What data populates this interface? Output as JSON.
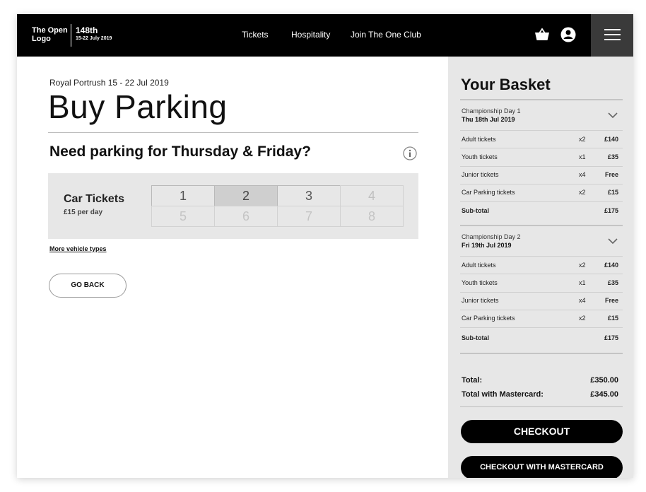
{
  "header": {
    "logo_line1": "The Open",
    "logo_line2": "Logo",
    "edition": "148th",
    "edition_dates": "15-22 July 2019",
    "nav": [
      "Tickets",
      "Hospitality",
      "Join The One Club"
    ],
    "icons": [
      "basket-icon",
      "user-icon",
      "menu-icon"
    ]
  },
  "main": {
    "subtitle": "Royal Portrush 15 - 22 Jul 2019",
    "title": "Buy Parking",
    "question": "Need parking for Thursday & Friday?",
    "tickets_title": "Car Tickets",
    "tickets_price": "£15 per day",
    "quantities": [
      "1",
      "2",
      "3",
      "4",
      "5",
      "6",
      "7",
      "8"
    ],
    "selected_quantity": "2",
    "more_link": "More vehicle types",
    "back_button": "GO BACK"
  },
  "basket": {
    "title": "Your Basket",
    "days": [
      {
        "name": "Championship Day 1",
        "date": "Thu 18th Jul 2019",
        "rows": [
          {
            "label": "Adult tickets",
            "qty": "x2",
            "price": "£140"
          },
          {
            "label": "Youth tickets",
            "qty": "x1",
            "price": "£35"
          },
          {
            "label": "Junior tickets",
            "qty": "x4",
            "price": "Free"
          },
          {
            "label": "Car Parking tickets",
            "qty": "x2",
            "price": "£15"
          }
        ],
        "subtotal_label": "Sub-total",
        "subtotal": "£175"
      },
      {
        "name": "Championship Day 2",
        "date": "Fri 19th Jul 2019",
        "rows": [
          {
            "label": "Adult tickets",
            "qty": "x2",
            "price": "£140"
          },
          {
            "label": "Youth tickets",
            "qty": "x1",
            "price": "£35"
          },
          {
            "label": "Junior tickets",
            "qty": "x4",
            "price": "Free"
          },
          {
            "label": "Car Parking tickets",
            "qty": "x2",
            "price": "£15"
          }
        ],
        "subtotal_label": "Sub-total",
        "subtotal": "£175"
      }
    ],
    "total_label": "Total:",
    "total": "£350.00",
    "mastercard_label": "Total with Mastercard:",
    "mastercard_total": "£345.00",
    "checkout": "CHECKOUT",
    "checkout_mastercard": "CHECKOUT WITH MASTERCARD"
  }
}
